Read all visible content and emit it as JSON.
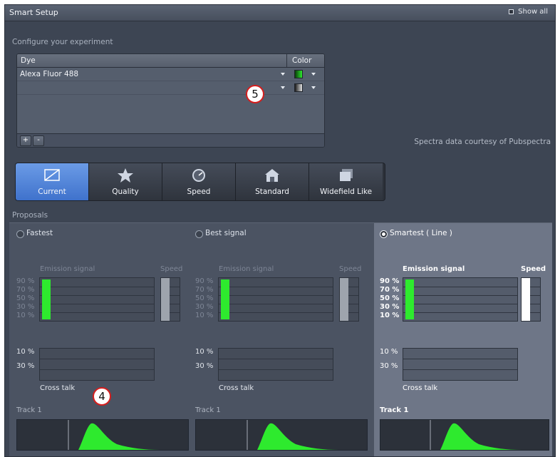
{
  "window": {
    "title": "Smart Setup",
    "show_all": "Show all"
  },
  "configure": {
    "heading": "Configure your experiment"
  },
  "dye_table": {
    "col_dye": "Dye",
    "col_color": "Color",
    "rows": [
      {
        "name": "Alexa Fluor 488",
        "color": "#2ee82e"
      },
      {
        "name": "",
        "color": "#d8d8d8"
      }
    ],
    "add_label": "+",
    "remove_label": "-"
  },
  "credit": "Spectra data courtesy of Pubspectra",
  "modes": [
    {
      "label": "Current",
      "icon": "current-icon",
      "active": true
    },
    {
      "label": "Quality",
      "icon": "star-icon",
      "active": false
    },
    {
      "label": "Speed",
      "icon": "speedometer-icon",
      "active": false
    },
    {
      "label": "Standard",
      "icon": "home-icon",
      "active": false
    },
    {
      "label": "Widefield Like",
      "icon": "widefield-icon",
      "active": false
    }
  ],
  "proposals": {
    "heading": "Proposals",
    "columns": [
      {
        "option": "Fastest",
        "selected": false,
        "emission_label": "Emission signal",
        "speed_label": "Speed",
        "ticks_top": [
          "90 %",
          "70 %",
          "50 %",
          "30 %",
          "10 %"
        ],
        "ticks_bottom": [
          "10 %",
          "30 %"
        ],
        "crosstalk_label": "Cross talk",
        "track_label": "Track 1"
      },
      {
        "option": "Best signal",
        "selected": false,
        "emission_label": "Emission signal",
        "speed_label": "Speed",
        "ticks_top": [
          "90 %",
          "70 %",
          "50 %",
          "30 %",
          "10 %"
        ],
        "ticks_bottom": [
          "10 %",
          "30 %"
        ],
        "crosstalk_label": "Cross talk",
        "track_label": "Track 1"
      },
      {
        "option": "Smartest ( Line )",
        "selected": true,
        "emission_label": "Emission signal",
        "speed_label": "Speed",
        "ticks_top": [
          "90 %",
          "70 %",
          "50 %",
          "30 %",
          "10 %"
        ],
        "ticks_bottom": [
          "10 %",
          "30 %"
        ],
        "crosstalk_label": "Cross talk",
        "track_label": "Track 1"
      }
    ]
  },
  "callouts": {
    "five": "5",
    "four": "4"
  },
  "colors": {
    "accent": "#4a7fd6",
    "signal": "#2eea2e"
  }
}
